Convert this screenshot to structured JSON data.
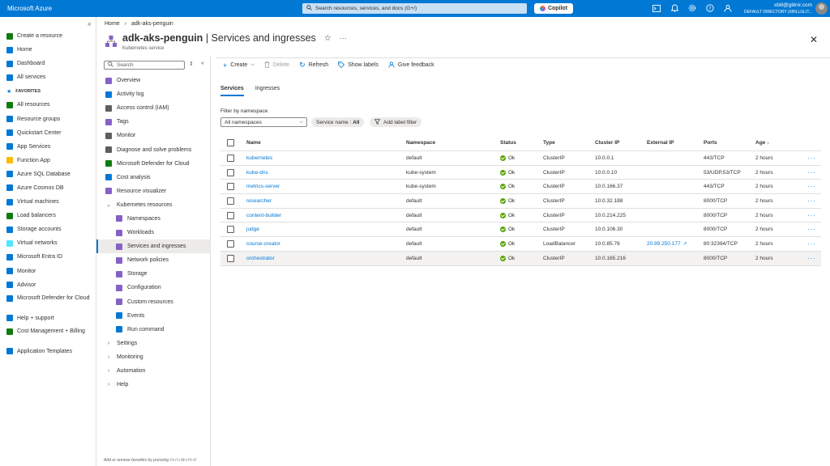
{
  "topbar": {
    "brand": "Microsoft Azure",
    "search_placeholder": "Search resources, services, and docs (G+/)",
    "copilot_label": "Copilot",
    "user_email": "xbill@glitnir.com",
    "user_directory": "DEFAULT DIRECTORY (XBILLGLIT...",
    "icons": [
      "cloud-shell-icon",
      "bell-icon",
      "gear-icon",
      "help-icon",
      "feedback-icon"
    ]
  },
  "leftnav": {
    "collapse_glyph": "«",
    "favorites_label": "FAVORITES",
    "top_items": [
      {
        "label": "Create a resource",
        "color": "#107c10"
      },
      {
        "label": "Home",
        "color": "#0078d4"
      },
      {
        "label": "Dashboard",
        "color": "#0078d4"
      },
      {
        "label": "All services",
        "color": "#0078d4"
      }
    ],
    "fav_items": [
      {
        "label": "All resources",
        "color": "#107c10"
      },
      {
        "label": "Resource groups",
        "color": "#0078d4"
      },
      {
        "label": "Quickstart Center",
        "color": "#0078d4"
      },
      {
        "label": "App Services",
        "color": "#0078d4"
      },
      {
        "label": "Function App",
        "color": "#ffb900"
      },
      {
        "label": "Azure SQL Database",
        "color": "#0078d4"
      },
      {
        "label": "Azure Cosmos DB",
        "color": "#0078d4"
      },
      {
        "label": "Virtual machines",
        "color": "#0078d4"
      },
      {
        "label": "Load balancers",
        "color": "#107c10"
      },
      {
        "label": "Storage accounts",
        "color": "#0078d4"
      },
      {
        "label": "Virtual networks",
        "color": "#50e6ff"
      },
      {
        "label": "Microsoft Entra ID",
        "color": "#0078d4"
      },
      {
        "label": "Monitor",
        "color": "#0078d4"
      },
      {
        "label": "Advisor",
        "color": "#0078d4"
      },
      {
        "label": "Microsoft Defender for Cloud",
        "color": "#0078d4"
      },
      {
        "label": "Help + support",
        "color": "#0078d4"
      },
      {
        "label": "Cost Management + Billing",
        "color": "#107c10"
      },
      {
        "label": "Application Templates",
        "color": "#0078d4"
      }
    ]
  },
  "header": {
    "breadcrumb_home": "Home",
    "breadcrumb_sep": "›",
    "breadcrumb_resource": "adk-aks-penguin",
    "resource_name": "adk-aks-penguin",
    "title_sep": "|",
    "page_name": "Services and ingresses",
    "subtitle": "Kubernetes service",
    "star": "☆",
    "more": "···",
    "close": "✕"
  },
  "resmenu": {
    "search_placeholder": "Search",
    "footnote_prefix": "Add or remove favorites by pressing ",
    "footnote_keys": "Ctrl+Shift+F",
    "items": [
      {
        "label": "Overview",
        "type": "item",
        "color": "#8661c5"
      },
      {
        "label": "Activity log",
        "type": "item",
        "color": "#0078d4"
      },
      {
        "label": "Access control (IAM)",
        "type": "item",
        "color": "#605e5c"
      },
      {
        "label": "Tags",
        "type": "item",
        "color": "#8661c5"
      },
      {
        "label": "Monitor",
        "type": "item",
        "color": "#605e5c"
      },
      {
        "label": "Diagnose and solve problems",
        "type": "item",
        "color": "#605e5c"
      },
      {
        "label": "Microsoft Defender for Cloud",
        "type": "item",
        "color": "#107c10"
      },
      {
        "label": "Cost analysis",
        "type": "item",
        "color": "#0078d4"
      },
      {
        "label": "Resource visualizer",
        "type": "item",
        "color": "#8661c5"
      },
      {
        "label": "Kubernetes resources",
        "type": "group-open"
      },
      {
        "label": "Namespaces",
        "type": "sub",
        "color": "#8661c5"
      },
      {
        "label": "Workloads",
        "type": "sub",
        "color": "#8661c5"
      },
      {
        "label": "Services and ingresses",
        "type": "sub-selected",
        "color": "#8661c5"
      },
      {
        "label": "Network policies",
        "type": "sub",
        "color": "#8661c5"
      },
      {
        "label": "Storage",
        "type": "sub",
        "color": "#8661c5"
      },
      {
        "label": "Configuration",
        "type": "sub",
        "color": "#8661c5"
      },
      {
        "label": "Custom resources",
        "type": "sub",
        "color": "#8661c5"
      },
      {
        "label": "Events",
        "type": "sub",
        "color": "#0078d4"
      },
      {
        "label": "Run command",
        "type": "sub",
        "color": "#0078d4"
      },
      {
        "label": "Settings",
        "type": "group"
      },
      {
        "label": "Monitoring",
        "type": "group"
      },
      {
        "label": "Automation",
        "type": "group"
      },
      {
        "label": "Help",
        "type": "group"
      }
    ]
  },
  "commandbar": {
    "create": "Create",
    "delete": "Delete",
    "refresh": "Refresh",
    "show_labels": "Show labels",
    "give_feedback": "Give feedback"
  },
  "tabs": [
    "Services",
    "Ingresses"
  ],
  "filter": {
    "label": "Filter by namespace",
    "namespace_value": "All namespaces",
    "service_name_pill": "Service name : ",
    "service_name_value": "All",
    "add_label_filter": "Add label filter"
  },
  "table": {
    "columns": [
      "Name",
      "Namespace",
      "Status",
      "Type",
      "Cluster IP",
      "External IP",
      "Ports",
      "Age ↓"
    ],
    "rows": [
      {
        "name": "kubernetes",
        "namespace": "default",
        "status": "Ok",
        "type": "ClusterIP",
        "cluster_ip": "10.0.0.1",
        "external_ip": "",
        "ports": "443/TCP",
        "age": "2 hours"
      },
      {
        "name": "kube-dns",
        "namespace": "kube-system",
        "status": "Ok",
        "type": "ClusterIP",
        "cluster_ip": "10.0.0.10",
        "external_ip": "",
        "ports": "53/UDP,53/TCP",
        "age": "2 hours"
      },
      {
        "name": "metrics-server",
        "namespace": "kube-system",
        "status": "Ok",
        "type": "ClusterIP",
        "cluster_ip": "10.0.166.37",
        "external_ip": "",
        "ports": "443/TCP",
        "age": "2 hours"
      },
      {
        "name": "researcher",
        "namespace": "default",
        "status": "Ok",
        "type": "ClusterIP",
        "cluster_ip": "10.0.32.188",
        "external_ip": "",
        "ports": "8000/TCP",
        "age": "2 hours"
      },
      {
        "name": "content-builder",
        "namespace": "default",
        "status": "Ok",
        "type": "ClusterIP",
        "cluster_ip": "10.0.214.225",
        "external_ip": "",
        "ports": "8000/TCP",
        "age": "2 hours"
      },
      {
        "name": "judge",
        "namespace": "default",
        "status": "Ok",
        "type": "ClusterIP",
        "cluster_ip": "10.0.106.30",
        "external_ip": "",
        "ports": "8000/TCP",
        "age": "2 hours"
      },
      {
        "name": "course-creator",
        "namespace": "default",
        "status": "Ok",
        "type": "LoadBalancer",
        "cluster_ip": "10.0.85.76",
        "external_ip": "20.99.250.177",
        "ports": "80:32394/TCP",
        "age": "2 hours"
      },
      {
        "name": "orchestrator",
        "namespace": "default",
        "status": "Ok",
        "type": "ClusterIP",
        "cluster_ip": "10.0.165.216",
        "external_ip": "",
        "ports": "8000/TCP",
        "age": "2 hours",
        "highlighted": true
      }
    ],
    "row_more": "···"
  },
  "colors": {
    "accent": "#0078d4",
    "ok": "#57a300",
    "topbar": "#0078d4"
  }
}
